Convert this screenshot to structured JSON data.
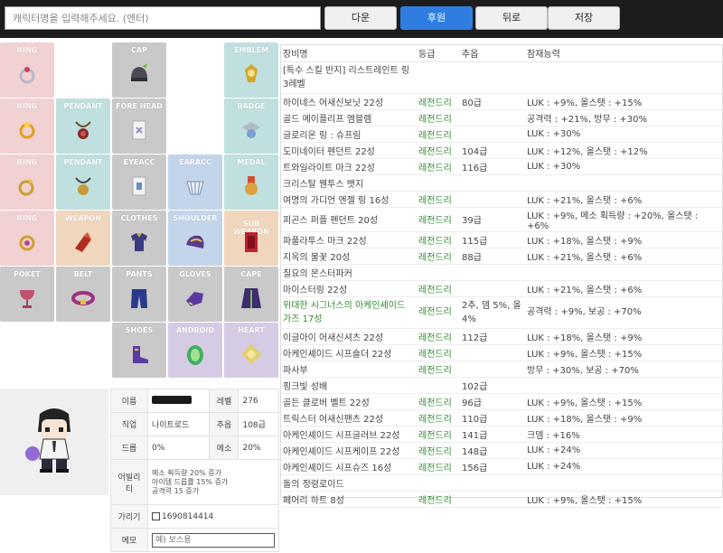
{
  "topbar": {
    "search_placeholder": "캐릭터명을 입력해주세요. (엔터)",
    "buttons": {
      "next": "다운",
      "sponsor": "후원",
      "back": "뒤로",
      "save": "저장"
    },
    "colors": {
      "bar": "#1c1c1c",
      "primary": "#2f7de1"
    }
  },
  "equip_slots": [
    {
      "label": "RING",
      "icon": "ring-icon"
    },
    {
      "label": "CAP",
      "icon": "helmet-icon"
    },
    {
      "label": "EMBLEM",
      "icon": "emblem-icon"
    },
    {
      "label": "RING",
      "icon": "ring-icon"
    },
    {
      "label": "PENDANT",
      "icon": "pendant-icon"
    },
    {
      "label": "FORE HEAD",
      "icon": "forehead-icon"
    },
    {
      "label": "BADGE",
      "icon": "badge-icon"
    },
    {
      "label": "RING",
      "icon": "ring-icon"
    },
    {
      "label": "PENDANT",
      "icon": "pendant-icon"
    },
    {
      "label": "EYEACC",
      "icon": "eye-accessory-icon"
    },
    {
      "label": "EARACC",
      "icon": "earring-icon"
    },
    {
      "label": "MEDAL",
      "icon": "medal-icon"
    },
    {
      "label": "RING",
      "icon": "ring-icon"
    },
    {
      "label": "WEAPON",
      "icon": "weapon-icon"
    },
    {
      "label": "CLOTHES",
      "icon": "clothes-icon"
    },
    {
      "label": "SHOULDER",
      "icon": "shoulder-icon"
    },
    {
      "label": "SUB WEAPON",
      "icon": "sub-weapon-icon"
    },
    {
      "label": "POKET",
      "icon": "pocket-icon"
    },
    {
      "label": "BELT",
      "icon": "belt-icon"
    },
    {
      "label": "PANTS",
      "icon": "pants-icon"
    },
    {
      "label": "GLOVES",
      "icon": "gloves-icon"
    },
    {
      "label": "CAPE",
      "icon": "cape-icon"
    },
    {
      "label": "SHOES",
      "icon": "shoes-icon"
    },
    {
      "label": "ANDROID",
      "icon": "android-icon"
    },
    {
      "label": "HEART",
      "icon": "heart-icon"
    }
  ],
  "character": {
    "name_label": "이름",
    "level_label": "레벨",
    "level": "276",
    "job_label": "직업",
    "job": "나이트로드",
    "cho_label": "추옵",
    "cho": "108급",
    "drop_label": "드롭",
    "drop": "0%",
    "meso_label": "메소",
    "meso": "20%",
    "ability_label": "어빌리티",
    "ability_lines": [
      "메소 획득량 20% 증가",
      "아이템 드롭률 15% 증가",
      "공격력 15 증가"
    ],
    "hide_label": "가리기",
    "hide_value": "1690814414",
    "memo_label": "메모",
    "memo_placeholder": "예) 보스용"
  },
  "item_table": {
    "headers": [
      "장비명",
      "등급",
      "추옵",
      "잠재능력"
    ],
    "rows": [
      {
        "name": "[특수 스킬 반지] 리스트레인트 링 3레벨",
        "grade": "",
        "cho": "",
        "potential": "",
        "tall": true
      },
      {
        "name": "하이네스 어새신보닛 22성",
        "grade": "레전드리",
        "cho": "80급",
        "potential": "LUK : +9%, 올스탯 : +15%"
      },
      {
        "name": "골드 메이플리프 엠블렘",
        "grade": "레전드리",
        "cho": "",
        "potential": "공격력 : +21%, 방무 : +30%"
      },
      {
        "name": "글로리온 링 : 슈프림",
        "grade": "레전드리",
        "cho": "",
        "potential": "LUK : +30%"
      },
      {
        "name": "도미네이터 펜던트 22성",
        "grade": "레전드리",
        "cho": "104급",
        "potential": "LUK : +12%, 올스탯 : +12%"
      },
      {
        "name": "트와일라이트 마크 22성",
        "grade": "레전드리",
        "cho": "116급",
        "potential": "LUK : +30%"
      },
      {
        "name": "크리스탈 웬투스 뱃지",
        "grade": "",
        "cho": "",
        "potential": ""
      },
      {
        "name": "여명의 가디언 엔젤 링 16성",
        "grade": "레전드리",
        "cho": "",
        "potential": "LUK : +21%, 올스탯 : +6%"
      },
      {
        "name": "피곤스 퍼플 펜던트 20성",
        "grade": "레전드리",
        "cho": "39급",
        "potential": "LUK : +9%, 메소 획득량 : +20%, 올스탯 : +6%"
      },
      {
        "name": "파풀라투스 마크 22성",
        "grade": "레전드리",
        "cho": "115급",
        "potential": "LUK : +18%, 올스탯 : +9%"
      },
      {
        "name": "지옥의 불꽃 20성",
        "grade": "레전드리",
        "cho": "88급",
        "potential": "LUK : +21%, 올스탯 : +6%"
      },
      {
        "name": "칠요의 몬스터파커",
        "grade": "",
        "cho": "",
        "potential": ""
      },
      {
        "name": "마이스터링 22성",
        "grade": "레전드리",
        "cho": "",
        "potential": "LUK : +21%, 올스탯 : +6%"
      },
      {
        "name": "위대한 시그너스의 아케인셰이드 가즈 17성",
        "grade": "레전드리",
        "cho": "2추, 뎀 5%, 올 4%",
        "potential": "공격력 : +9%, 보공 : +70%",
        "tall": true,
        "green_name": true
      },
      {
        "name": "이글아이 어새신셔츠 22성",
        "grade": "레전드리",
        "cho": "112급",
        "potential": "LUK : +18%, 올스탯 : +9%"
      },
      {
        "name": "아케인셰이드 시프숄더 22성",
        "grade": "레전드리",
        "cho": "",
        "potential": "LUK : +9%, 올스탯 : +15%"
      },
      {
        "name": "파사부",
        "grade": "레전드리",
        "cho": "",
        "potential": "방무 : +30%, 보공 : +70%"
      },
      {
        "name": "핑크빛 성배",
        "grade": "",
        "cho": "102급",
        "potential": ""
      },
      {
        "name": "골든 클로버 벨트 22성",
        "grade": "레전드리",
        "cho": "96급",
        "potential": "LUK : +9%, 올스탯 : +15%"
      },
      {
        "name": "트릭스터 어새신팬츠 22성",
        "grade": "레전드리",
        "cho": "110급",
        "potential": "LUK : +18%, 올스탯 : +9%"
      },
      {
        "name": "아케인셰이드 시프글러브 22성",
        "grade": "레전드리",
        "cho": "141급",
        "potential": "크뎀 : +16%"
      },
      {
        "name": "아케인셰이드 시프케이프 22성",
        "grade": "레전드리",
        "cho": "148급",
        "potential": "LUK : +24%"
      },
      {
        "name": "아케인셰이드 시프슈즈 16성",
        "grade": "레전드리",
        "cho": "156급",
        "potential": "LUK : +24%"
      },
      {
        "name": "돌의 정령로이드",
        "grade": "",
        "cho": "",
        "potential": ""
      },
      {
        "name": "페어리 하트 8성",
        "grade": "레전드리",
        "cho": "",
        "potential": "LUK : +9%, 올스탯 : +15%"
      }
    ]
  }
}
